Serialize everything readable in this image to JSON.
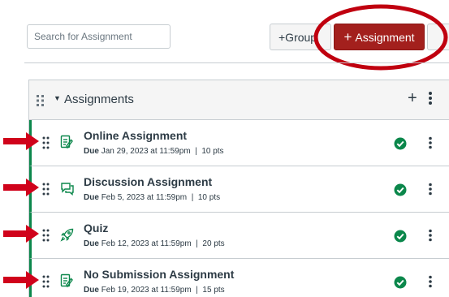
{
  "toolbar": {
    "search_placeholder": "Search for Assignment",
    "group_button_label": "+Group",
    "assignment_button_plus": "+",
    "assignment_button_label": "Assignment"
  },
  "group": {
    "title": "Assignments",
    "caret": "▼",
    "add": "+"
  },
  "assignments": [
    {
      "title": "Online Assignment",
      "due_label": "Due",
      "due": "Jan 29, 2023 at 11:59pm",
      "points": "10 pts",
      "icon": "assignment-icon"
    },
    {
      "title": "Discussion Assignment",
      "due_label": "Due",
      "due": "Feb 5, 2023 at 11:59pm",
      "points": "10 pts",
      "icon": "discussion-icon"
    },
    {
      "title": "Quiz",
      "due_label": "Due",
      "due": "Feb 12, 2023 at 11:59pm",
      "points": "20 pts",
      "icon": "quiz-icon"
    },
    {
      "title": "No Submission Assignment",
      "due_label": "Due",
      "due": "Feb 19, 2023 at 11:59pm",
      "points": "15 pts",
      "icon": "assignment-icon"
    }
  ],
  "colors": {
    "accent_button": "#a3201d",
    "highlight_annotation": "#c0000f",
    "published_green": "#0b874b",
    "arrow_red": "#d0021b"
  }
}
